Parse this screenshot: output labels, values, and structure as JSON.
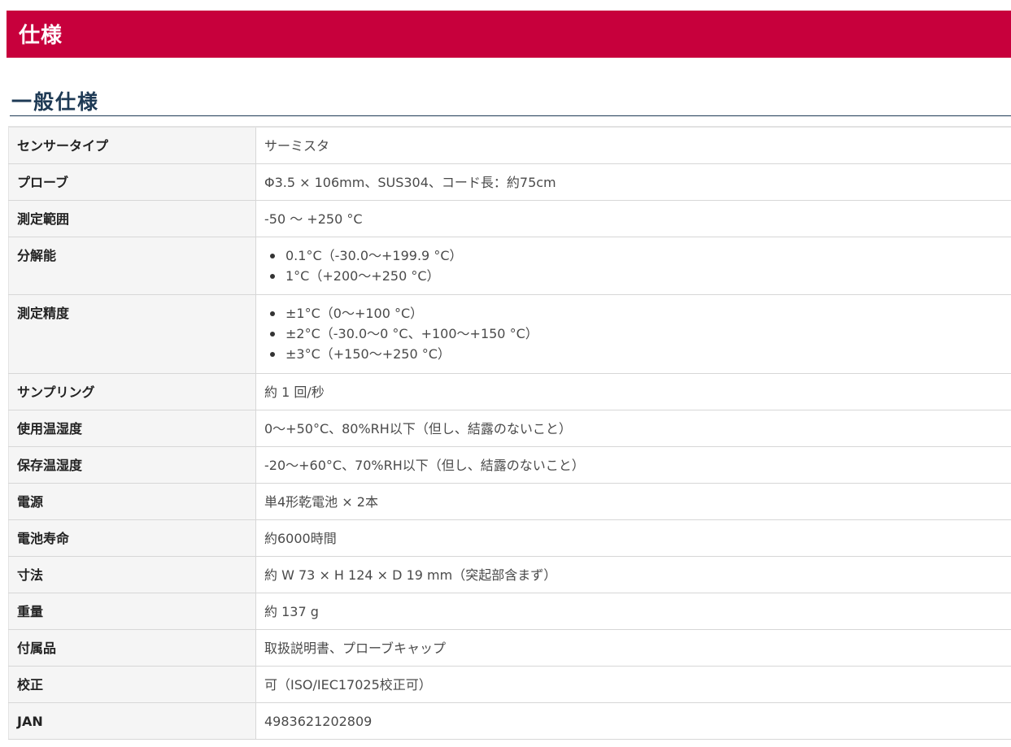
{
  "page": {
    "banner_title": "仕様",
    "section_title": "一般仕様"
  },
  "specs": {
    "sensor_type": {
      "label": "センサータイプ",
      "value": "サーミスタ"
    },
    "probe": {
      "label": "プローブ",
      "value": "Φ3.5 × 106mm、SUS304、コード長：約75cm"
    },
    "measurement_range": {
      "label": "測定範囲",
      "value": "-50 〜 +250 °C"
    },
    "resolution": {
      "label": "分解能",
      "items": [
        "0.1°C（-30.0〜+199.9 °C）",
        "1°C（+200〜+250 °C）"
      ]
    },
    "accuracy": {
      "label": "測定精度",
      "items": [
        "±1°C（0〜+100 °C）",
        "±2°C（-30.0〜0 °C、+100〜+150 °C）",
        "±3°C（+150〜+250 °C）"
      ]
    },
    "sampling": {
      "label": "サンプリング",
      "value": "約 1 回/秒"
    },
    "operating_env": {
      "label": "使用温湿度",
      "value": "0〜+50°C、80%RH以下（但し、結露のないこと）"
    },
    "storage_env": {
      "label": "保存温湿度",
      "value": "-20〜+60°C、70%RH以下（但し、結露のないこと）"
    },
    "power": {
      "label": "電源",
      "value": "単4形乾電池 × 2本"
    },
    "battery_life": {
      "label": "電池寿命",
      "value": "約6000時間"
    },
    "dimensions": {
      "label": "寸法",
      "value": "約 W 73 × H 124 × D 19 mm（突起部含まず）"
    },
    "weight": {
      "label": "重量",
      "value": "約 137 g"
    },
    "accessories": {
      "label": "付属品",
      "value": "取扱説明書、プローブキャップ"
    },
    "calibration": {
      "label": "校正",
      "value": "可（ISO/IEC17025校正可）"
    },
    "jan": {
      "label": "JAN",
      "value": "4983621202809"
    }
  },
  "colors": {
    "banner": "#c7003c",
    "heading": "#1e3a55",
    "label_bg": "#f5f5f5",
    "border": "#d7d7d7"
  }
}
